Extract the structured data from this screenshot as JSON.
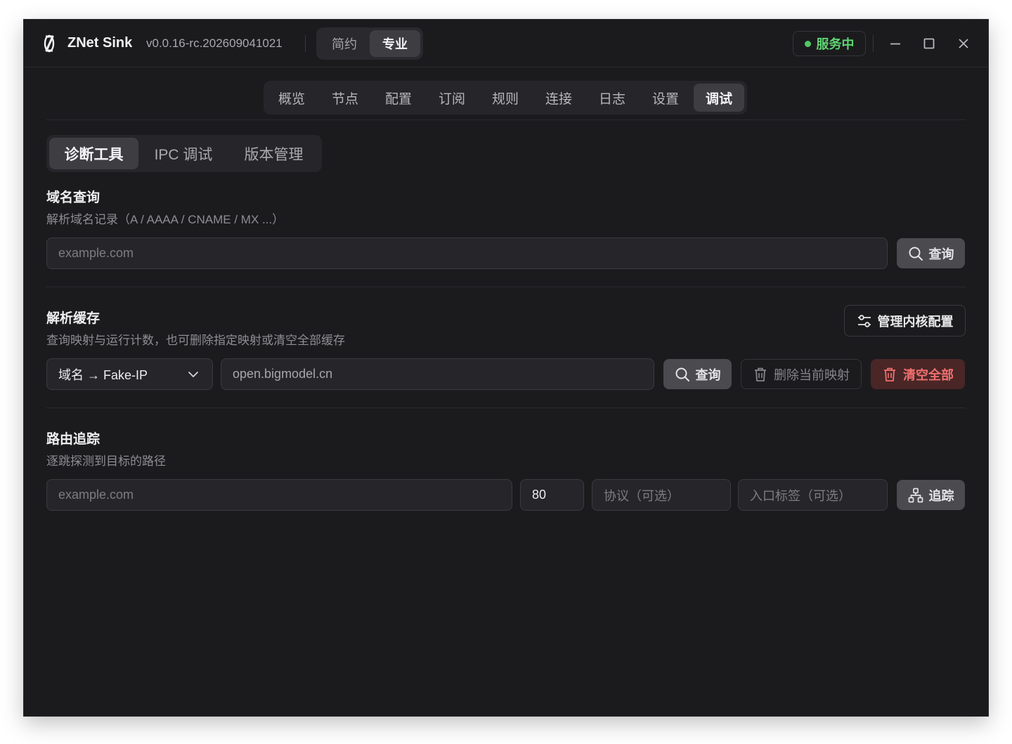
{
  "app": {
    "name": "ZNet Sink",
    "version": "v0.0.16-rc.202609041021",
    "modes": [
      "简约",
      "专业"
    ],
    "active_mode": "专业",
    "status": "服务中",
    "status_color": "#4fc766"
  },
  "nav": {
    "items": [
      "概览",
      "节点",
      "配置",
      "订阅",
      "规则",
      "连接",
      "日志",
      "设置",
      "调试"
    ],
    "active": "调试"
  },
  "subtabs": {
    "items": [
      "诊断工具",
      "IPC 调试",
      "版本管理"
    ],
    "active": "诊断工具"
  },
  "dns": {
    "title": "域名查询",
    "desc": "解析域名记录（A / AAAA / CNAME / MX ...）",
    "placeholder": "example.com",
    "query_label": "查询"
  },
  "cache": {
    "title": "解析缓存",
    "desc": "查询映射与运行计数，也可删除指定映射或清空全部缓存",
    "manage_label": "管理内核配置",
    "select_value": "域名 → Fake-IP",
    "input_value": "open.bigmodel.cn",
    "query_label": "查询",
    "delete_label": "删除当前映射",
    "clear_label": "清空全部",
    "danger_color": "#f07070"
  },
  "trace": {
    "title": "路由追踪",
    "desc": "逐跳探测到目标的路径",
    "host_placeholder": "example.com",
    "port_value": "80",
    "protocol_placeholder": "协议（可选）",
    "inbound_placeholder": "入口标签（可选）",
    "trace_label": "追踪"
  }
}
